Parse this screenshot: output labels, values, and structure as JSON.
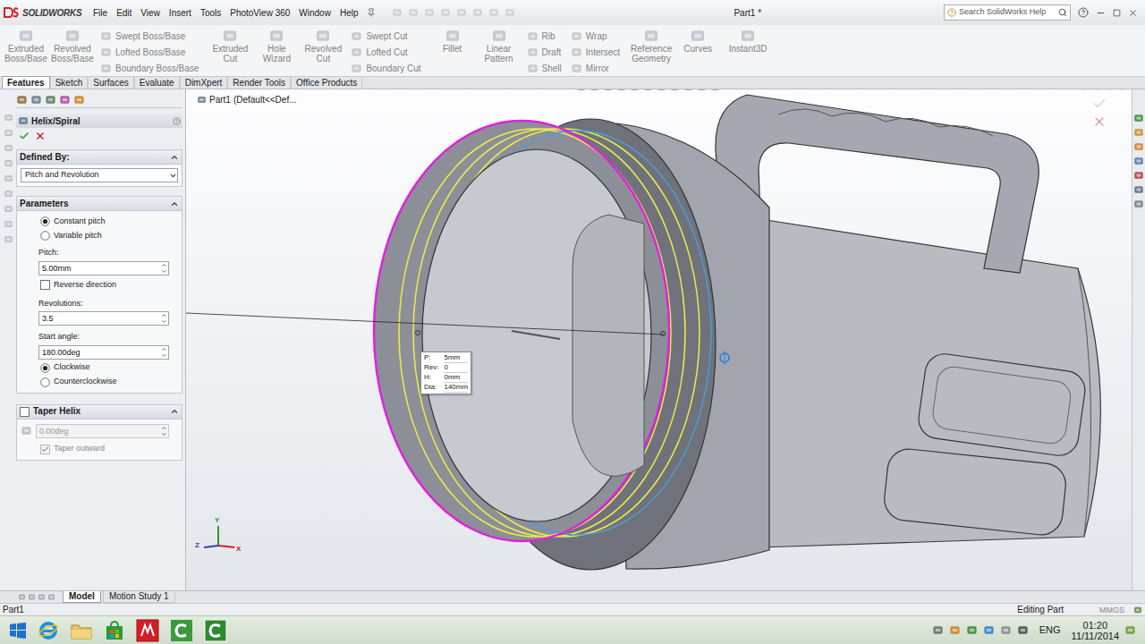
{
  "app": {
    "logo": "SOLIDWORKS",
    "document_title": "Part1 *",
    "search_placeholder": "Search SolidWorks Help"
  },
  "menu": [
    "File",
    "Edit",
    "View",
    "Insert",
    "Tools",
    "PhotoView 360",
    "Window",
    "Help"
  ],
  "ribbon": [
    {
      "kind": "large",
      "items": [
        {
          "label": "Extruded Boss/Base",
          "disabled": true
        },
        {
          "label": "Revolved Boss/Base",
          "disabled": true
        }
      ]
    },
    {
      "kind": "small",
      "items": [
        {
          "label": "Swept Boss/Base",
          "disabled": true
        },
        {
          "label": "Lofted Boss/Base",
          "disabled": true
        },
        {
          "label": "Boundary Boss/Base",
          "disabled": true
        }
      ]
    },
    {
      "kind": "large",
      "items": [
        {
          "label": "Extruded Cut",
          "disabled": true
        },
        {
          "label": "Hole Wizard",
          "disabled": true
        },
        {
          "label": "Revolved Cut",
          "disabled": true
        }
      ]
    },
    {
      "kind": "small",
      "items": [
        {
          "label": "Swept Cut",
          "disabled": true
        },
        {
          "label": "Lofted Cut",
          "disabled": true
        },
        {
          "label": "Boundary Cut",
          "disabled": true
        }
      ]
    },
    {
      "kind": "large",
      "items": [
        {
          "label": "Fillet",
          "disabled": true
        },
        {
          "label": "Linear Pattern",
          "disabled": true
        }
      ]
    },
    {
      "kind": "small",
      "items": [
        {
          "label": "Rib",
          "disabled": true
        },
        {
          "label": "Draft",
          "disabled": true
        },
        {
          "label": "Shell",
          "disabled": true
        }
      ]
    },
    {
      "kind": "small",
      "items": [
        {
          "label": "Wrap",
          "disabled": true
        },
        {
          "label": "Intersect",
          "disabled": true
        },
        {
          "label": "Mirror",
          "disabled": true
        }
      ]
    },
    {
      "kind": "large",
      "items": [
        {
          "label": "Reference Geometry",
          "disabled": true
        },
        {
          "label": "Curves",
          "disabled": true
        }
      ]
    },
    {
      "kind": "large",
      "items": [
        {
          "label": "Instant3D",
          "disabled": true
        }
      ]
    }
  ],
  "tabs": [
    {
      "label": "Features",
      "selected": true
    },
    {
      "label": "Sketch",
      "selected": false
    },
    {
      "label": "Surfaces",
      "selected": false
    },
    {
      "label": "Evaluate",
      "selected": false
    },
    {
      "label": "DimXpert",
      "selected": false
    },
    {
      "label": "Render Tools",
      "selected": false
    },
    {
      "label": "Office Products",
      "selected": false
    }
  ],
  "feature_tree": {
    "part": "Part1",
    "configuration": "(Default<<Def..."
  },
  "property_manager": {
    "title": "Helix/Spiral",
    "defined_by": {
      "title": "Defined By:",
      "value": "Pitch and Revolution",
      "expanded": true
    },
    "parameters": {
      "title": "Parameters",
      "expanded": true,
      "rows": [
        {
          "kind": "radio",
          "label": "Constant pitch",
          "selected": true
        },
        {
          "kind": "radio",
          "label": "Variable pitch",
          "selected": false
        },
        {
          "kind": "field",
          "label": "Pitch:",
          "value": "5.00mm"
        },
        {
          "kind": "checkbox",
          "label": "Reverse direction",
          "checked": false
        },
        {
          "kind": "field",
          "label": "Revolutions:",
          "value": "3.5"
        },
        {
          "kind": "field",
          "label": "Start angle:",
          "value": "180.00deg"
        },
        {
          "kind": "radio",
          "label": "Clockwise",
          "selected": true
        },
        {
          "kind": "radio",
          "label": "Counterclockwise",
          "selected": false
        }
      ]
    },
    "taper": {
      "title": "Taper Helix",
      "checked": false,
      "expanded": true,
      "angle": "0.00deg",
      "disabled": true,
      "taper_outward": {
        "label": "Taper outward",
        "checked": true,
        "disabled": true
      }
    }
  },
  "helix_tooltip": [
    {
      "label": "P:",
      "value": "5mm"
    },
    {
      "label": "Rev:",
      "value": "0"
    },
    {
      "label": "H:",
      "value": "0mm"
    },
    {
      "label": "Dia:",
      "value": "140mm"
    }
  ],
  "triad": [
    {
      "label": "Y",
      "color": "#2f9a2f"
    },
    {
      "label": "Z",
      "color": "#2a3fbf"
    },
    {
      "label": "X",
      "color": "#d02020"
    }
  ],
  "bottom_tabs": [
    {
      "label": "Model",
      "selected": true
    },
    {
      "label": "Motion Study 1",
      "selected": false
    }
  ],
  "status_bar": {
    "left": "Part1",
    "mode": "Editing Part",
    "units": "MMGS"
  },
  "taskbar": {
    "language": "ENG",
    "time": "01:20",
    "date": "11/11/2014"
  }
}
